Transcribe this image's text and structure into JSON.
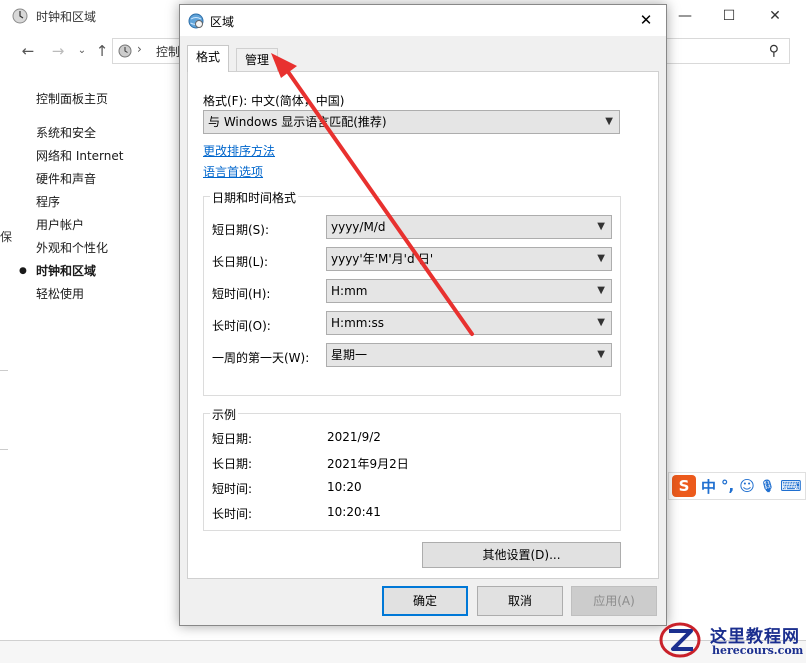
{
  "background_window": {
    "title": "时钟和区域",
    "address_text": "控制",
    "controls": {
      "minimize": "—",
      "maximize": "☐",
      "close": "✕"
    },
    "sidebar": {
      "home": "控制面板主页",
      "items": [
        "系统和安全",
        "网络和 Internet",
        "硬件和声音",
        "程序",
        "用户帐户",
        "外观和个性化",
        "时钟和区域",
        "轻松使用"
      ],
      "active_index": 6
    },
    "edge_char": "保"
  },
  "dialog": {
    "title": "区域",
    "close_glyph": "✕",
    "tabs": [
      {
        "label": "格式",
        "selected": true
      },
      {
        "label": "管理",
        "selected": false
      }
    ],
    "format_label": "格式(F): 中文(简体，中国)",
    "format_value": "与 Windows 显示语言匹配(推荐)",
    "links": {
      "sort": "更改排序方法",
      "lang_pref": "语言首选项"
    },
    "datetime_group": {
      "title": "日期和时间格式",
      "rows": [
        {
          "label": "短日期(S):",
          "value": "yyyy/M/d"
        },
        {
          "label": "长日期(L):",
          "value": "yyyy'年'M'月'd'日'"
        },
        {
          "label": "短时间(H):",
          "value": "H:mm"
        },
        {
          "label": "长时间(O):",
          "value": "H:mm:ss"
        },
        {
          "label": "一周的第一天(W):",
          "value": "星期一"
        }
      ]
    },
    "example_group": {
      "title": "示例",
      "rows": [
        {
          "label": "短日期:",
          "value": "2021/9/2"
        },
        {
          "label": "长日期:",
          "value": "2021年9月2日"
        },
        {
          "label": "短时间:",
          "value": "10:20"
        },
        {
          "label": "长时间:",
          "value": "10:20:41"
        }
      ]
    },
    "other_settings": "其他设置(D)...",
    "buttons": {
      "ok": "确定",
      "cancel": "取消",
      "apply": "应用(A)"
    }
  },
  "ime_toolbar": {
    "logo": "S",
    "lang": "中",
    "punct": "°,",
    "emoji": "☺",
    "mic": "🎙",
    "keyboard": "⌨"
  },
  "watermark": {
    "cn": "这里教程网",
    "en": "herecours.com"
  },
  "colors": {
    "arrow": "#e8312f",
    "link": "#0066cc",
    "focus": "#0078d7"
  }
}
